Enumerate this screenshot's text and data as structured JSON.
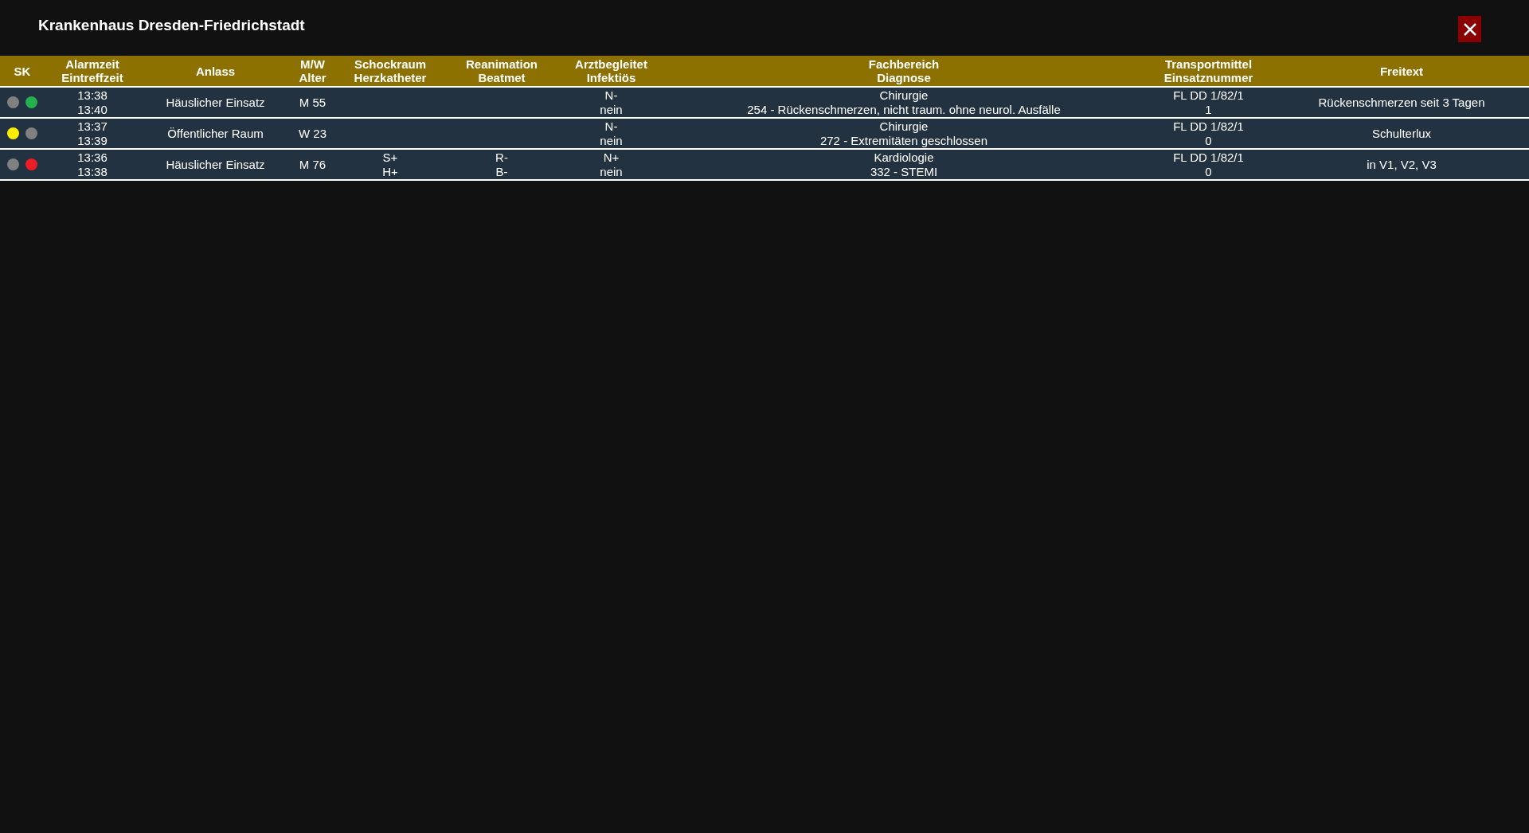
{
  "window": {
    "title": "Krankenhaus Dresden-Friedrichstadt"
  },
  "table": {
    "columns": [
      "SK",
      "Alarmzeit\nEintreffzeit",
      "Anlass",
      "M/W\nAlter",
      "Schockraum\nHerzkatheter",
      "Reanimation\nBeatmet",
      "Arztbegleitet\nInfektiös",
      "Fachbereich\nDiagnose",
      "Transportmittel\nEinsatznummer",
      "Freitext"
    ],
    "rows": [
      {
        "sk": [
          {
            "color": "#808080"
          },
          {
            "color": "#22b14c"
          }
        ],
        "cells": [
          "",
          "13:38\n13:40",
          "Häuslicher Einsatz",
          "M 55",
          "",
          "",
          "N-\nnein",
          "Chirurgie\n254 - Rückenschmerzen, nicht traum. ohne neurol. Ausfälle",
          "FL DD 1/82/1\n1",
          "Rückenschmerzen seit 3 Tagen"
        ]
      },
      {
        "sk": [
          {
            "color": "#ffee00"
          },
          {
            "color": "#808080"
          }
        ],
        "cells": [
          "",
          "13:37\n13:39",
          "Öffentlicher Raum",
          "W 23",
          "",
          "",
          "N-\nnein",
          "Chirurgie\n272 - Extremitäten geschlossen",
          "FL DD 1/82/1\n0",
          "Schulterlux"
        ]
      },
      {
        "sk": [
          {
            "color": "#808080"
          },
          {
            "color": "#ee1c24"
          }
        ],
        "cells": [
          "",
          "13:36\n13:38",
          "Häuslicher Einsatz",
          "M 76",
          "S+\nH+",
          "R-\nB-",
          "N+\nnein",
          "Kardiologie\n332 - STEMI",
          "FL DD 1/82/1\n0",
          "in V1, V2, V3"
        ]
      }
    ]
  }
}
